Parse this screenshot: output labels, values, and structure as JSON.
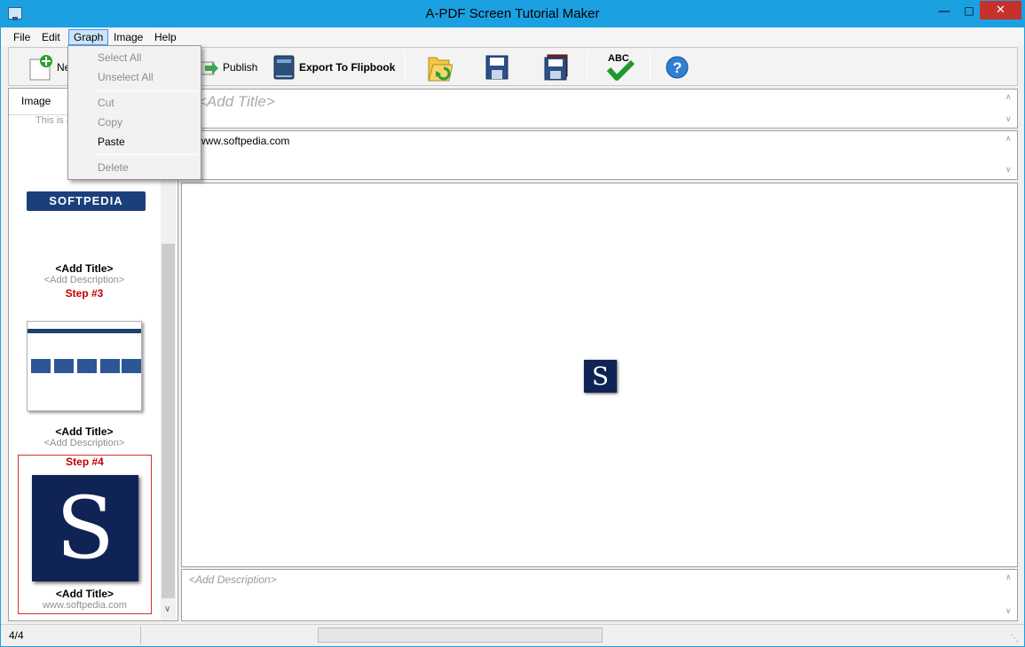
{
  "window": {
    "title": "A-PDF Screen Tutorial Maker"
  },
  "menubar": {
    "items": [
      "File",
      "Edit",
      "Graph",
      "Image",
      "Help"
    ]
  },
  "toolbar": {
    "new_label": "Ne",
    "publish_label": "Publish",
    "export_label": "Export To Flipbook"
  },
  "graph_menu": {
    "select_all": "Select All",
    "unselect_all": "Unselect All",
    "cut": "Cut",
    "copy": "Copy",
    "paste": "Paste",
    "delete": "Delete"
  },
  "left_panel": {
    "tab_label": "Image",
    "partial_text": "This is a",
    "softpedia_logo_text": "SOFTPEDIA",
    "steps": [
      {
        "title": "<Add Title>",
        "desc": "<Add Description>"
      },
      {
        "step_label": "Step #3",
        "title": "<Add Title>",
        "desc": "<Add Description>"
      },
      {
        "step_label": "Step #4",
        "title": "<Add Title>",
        "desc": "www.softpedia.com"
      }
    ]
  },
  "editor": {
    "title_placeholder": "<Add Title>",
    "url_text": "www.softpedia.com",
    "logo_letter": "S",
    "description_placeholder": "<Add Description>"
  },
  "statusbar": {
    "page": "4/4"
  },
  "icons": {
    "toolbar": [
      "new-icon",
      "publish-icon",
      "flipbook-icon",
      "open-folder-icon",
      "save-icon",
      "save-all-icon",
      "spellcheck-icon",
      "help-icon"
    ]
  }
}
